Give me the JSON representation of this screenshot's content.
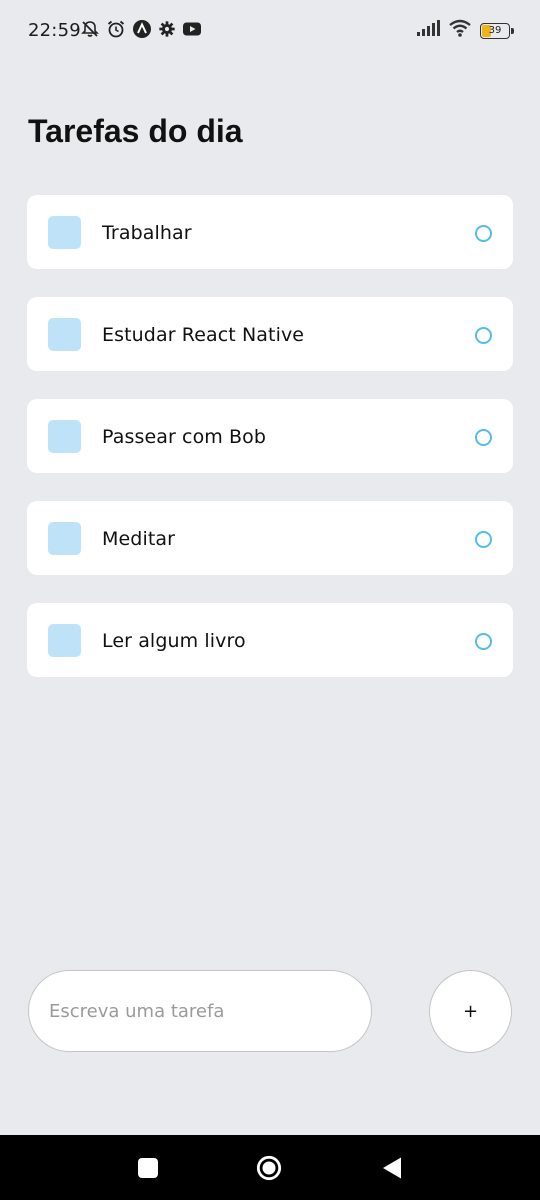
{
  "status_bar": {
    "time": "22:59",
    "left_icons": [
      "mute-notifications-icon",
      "alarm-icon",
      "app-a-icon",
      "settings-icon",
      "youtube-icon"
    ],
    "right_icons": [
      "signal-icon",
      "wifi-icon",
      "battery-icon"
    ],
    "battery": "39",
    "battery_color": "#f2b21a"
  },
  "page": {
    "title": "Tarefas do dia"
  },
  "tasks": [
    {
      "label": "Trabalhar"
    },
    {
      "label": "Estudar React Native"
    },
    {
      "label": "Passear com Bob"
    },
    {
      "label": "Meditar"
    },
    {
      "label": "Ler algum livro"
    }
  ],
  "input": {
    "placeholder": "Escreva uma tarefa",
    "value": ""
  },
  "add_button": {
    "label": "+"
  },
  "colors": {
    "background": "#e8eaed",
    "task_square": "#bee3f8",
    "task_circle": "#55bcea",
    "card": "#ffffff"
  },
  "nav_bar": {
    "buttons": [
      "recent-apps-icon",
      "home-icon",
      "back-icon"
    ]
  }
}
